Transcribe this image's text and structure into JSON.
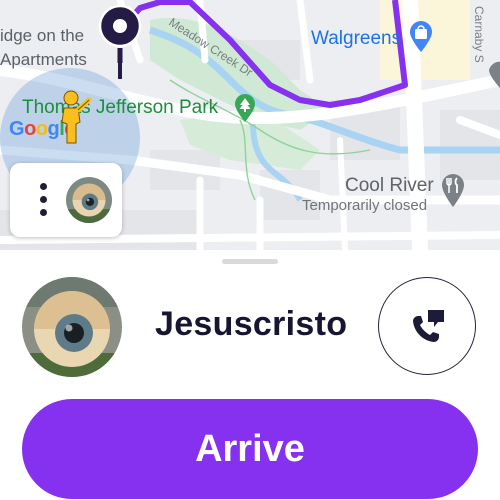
{
  "map": {
    "place_apartments_line1": "idge on the",
    "place_apartments_line2": "Apartments",
    "park": "Thomas Jefferson Park",
    "street_meadow": "Meadow Creek Dr",
    "street_right": "Carnaby S",
    "store": "Walgreens",
    "restaurant": "Cool River",
    "restaurant_status": "Temporarily closed",
    "logo_text": "Google",
    "route_color": "#8731f0",
    "icons": [
      "destination-pin-icon",
      "park-tree-icon",
      "shopping-bag-icon",
      "restaurant-fork-knife-icon",
      "pegman-icon"
    ]
  },
  "mini_card": {
    "menu_icon": "more-vert-icon",
    "avatar_icon": "eyeball-sculpture-avatar"
  },
  "driver": {
    "name": "Jesuscristo",
    "avatar_icon": "eyeball-sculpture-avatar",
    "call_icon": "phone-message-icon"
  },
  "actions": {
    "arrive_label": "Arrive",
    "accent_color": "#8731f0"
  }
}
